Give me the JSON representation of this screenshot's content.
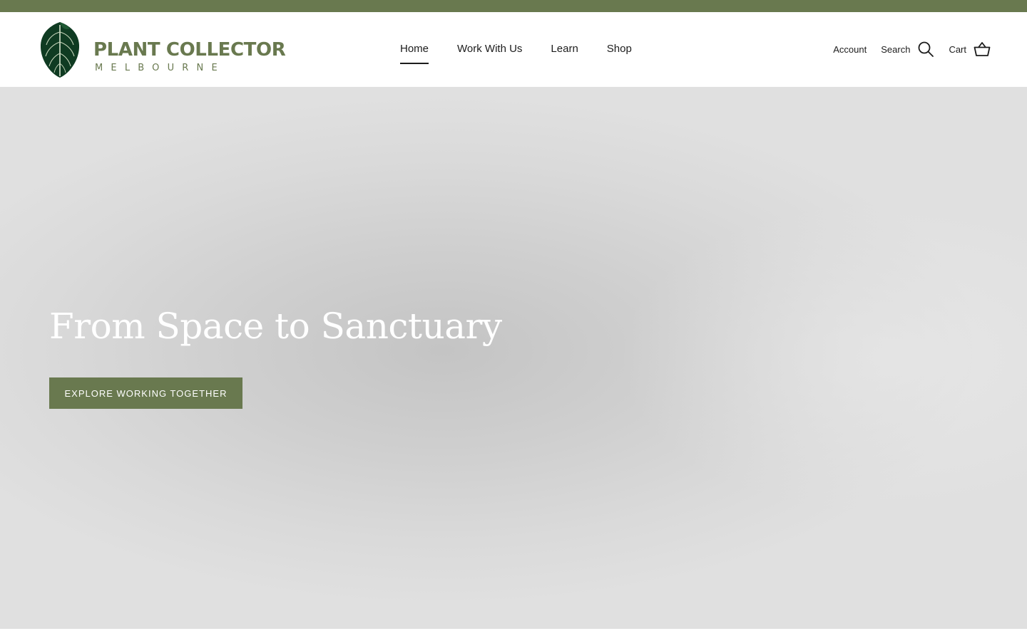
{
  "announcement_bar": {
    "color": "#69794f"
  },
  "brand": {
    "title": "PLANT COLLECTOR",
    "subtitle": "MELBOURNE",
    "logo_icon": "anthurium-leaf-icon",
    "color": "#69794f"
  },
  "nav": {
    "items": [
      {
        "label": "Home",
        "active": true
      },
      {
        "label": "Work With Us",
        "active": false
      },
      {
        "label": "Learn",
        "active": false
      },
      {
        "label": "Shop",
        "active": false
      }
    ]
  },
  "tools": {
    "account_label": "Account",
    "search_label": "Search",
    "search_icon": "search-icon",
    "cart_label": "Cart",
    "cart_icon": "basket-icon"
  },
  "hero": {
    "title": "From Space to Sanctuary",
    "button_label": "EXPLORE WORKING TOGETHER",
    "button_color": "#69794f"
  }
}
